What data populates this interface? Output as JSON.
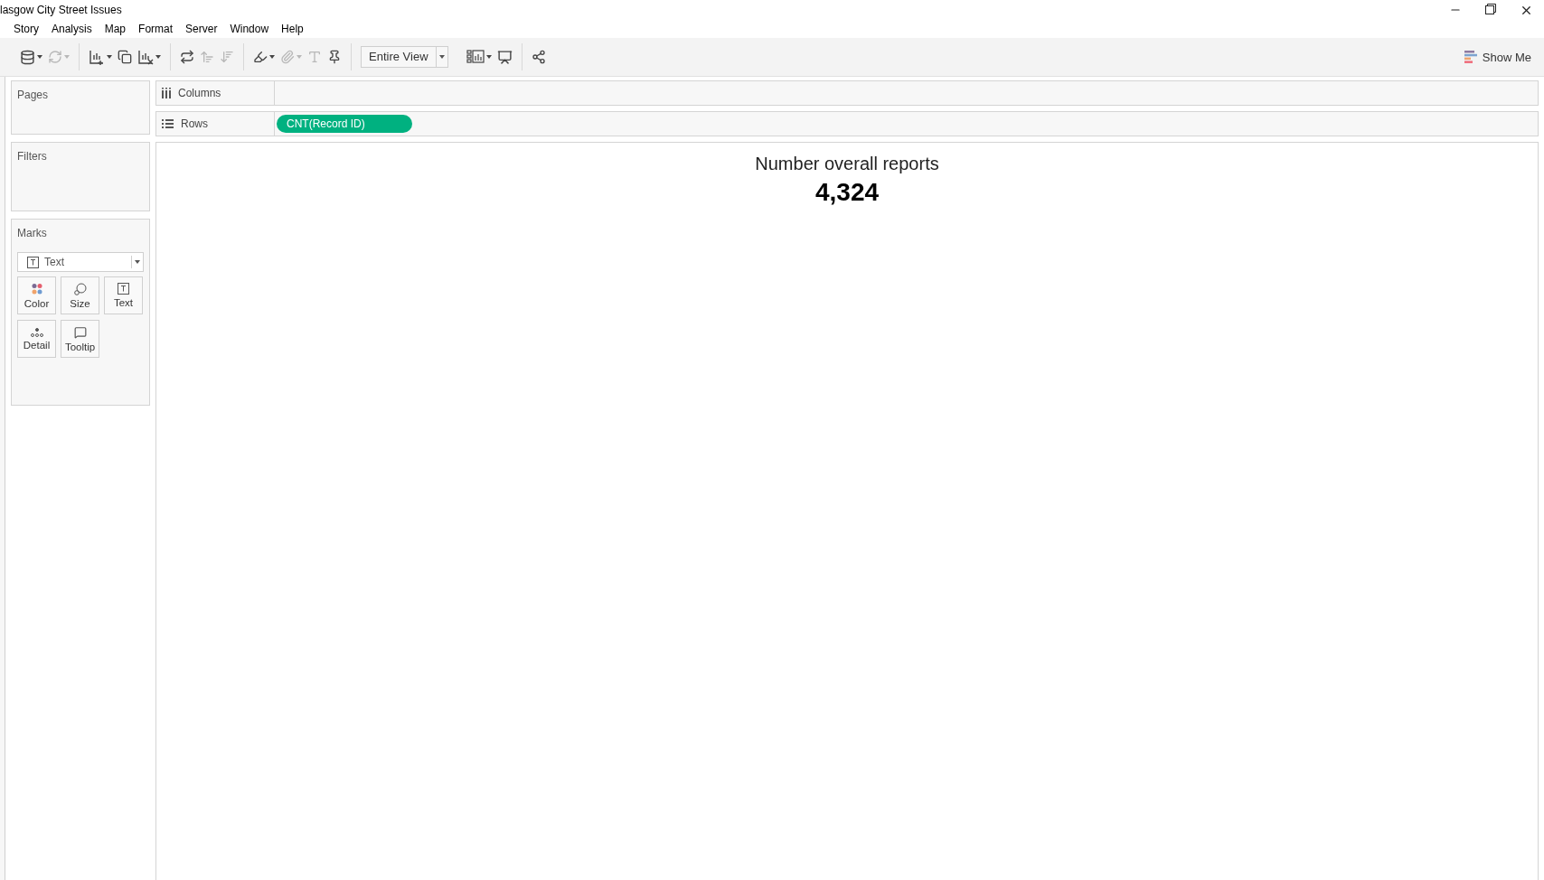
{
  "window": {
    "title": "lasgow City Street Issues"
  },
  "menu": [
    "Story",
    "Analysis",
    "Map",
    "Format",
    "Server",
    "Window",
    "Help"
  ],
  "toolbar": {
    "groups": [
      [
        {
          "disabled": false,
          "dropdown": true
        },
        {
          "disabled": true,
          "dropdown": true
        }
      ],
      [
        {
          "disabled": false,
          "dropdown": true
        },
        {
          "disabled": false,
          "dropdown": false
        },
        {
          "disabled": false,
          "dropdown": true
        }
      ],
      [
        {
          "disabled": false,
          "dropdown": false
        },
        {
          "disabled": true,
          "dropdown": false
        },
        {
          "disabled": true,
          "dropdown": false
        }
      ],
      [
        {
          "disabled": false,
          "dropdown": true
        },
        {
          "disabled": true,
          "dropdown": true
        },
        {
          "disabled": true,
          "dropdown": false
        },
        {
          "disabled": false,
          "dropdown": false
        }
      ]
    ],
    "fit": "Entire View",
    "after": [
      {
        "disabled": false,
        "dropdown": true
      },
      {
        "disabled": false,
        "dropdown": false
      }
    ],
    "share": {
      "disabled": false,
      "dropdown": false
    },
    "show_me": "Show Me"
  },
  "cards": {
    "pages": "Pages",
    "filters": "Filters",
    "marks": {
      "title": "Marks",
      "mark_type": "Text",
      "buttons": [
        "Color",
        "Size",
        "Text",
        "Detail",
        "Tooltip"
      ]
    }
  },
  "shelves": [
    {
      "label": "Columns"
    },
    {
      "label": "Rows",
      "pills": [
        "CNT(Record ID)"
      ]
    }
  ],
  "view": {
    "title": "Number overall reports",
    "value": "4,324"
  }
}
